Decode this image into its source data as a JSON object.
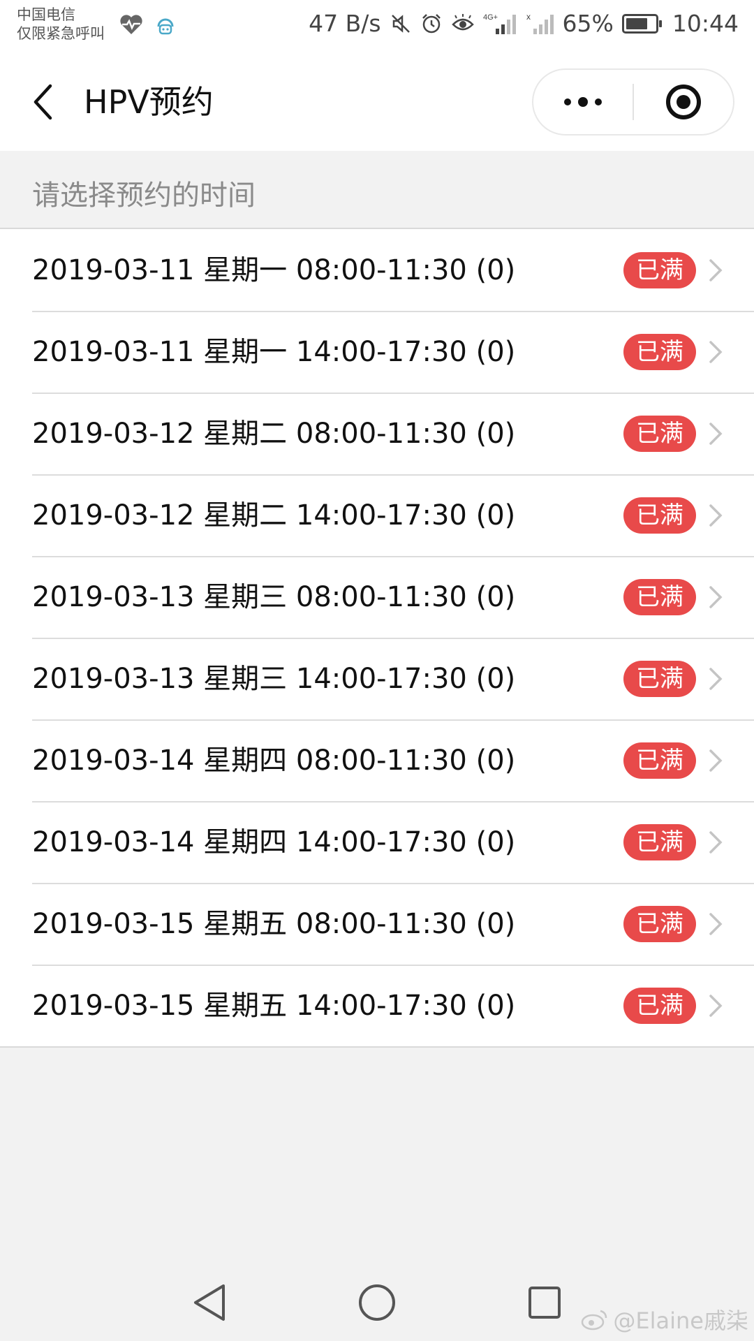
{
  "status_bar": {
    "carrier_line1": "中国电信",
    "carrier_line2": "仅限紧急呼叫",
    "net_speed": "47 B/s",
    "battery": "65%",
    "time": "10:44"
  },
  "nav": {
    "title": "HPV预约"
  },
  "section": {
    "header": "请选择预约的时间"
  },
  "slots": [
    {
      "text": "2019-03-11 星期一 08:00-11:30 (0)",
      "status": "已满"
    },
    {
      "text": "2019-03-11 星期一 14:00-17:30 (0)",
      "status": "已满"
    },
    {
      "text": "2019-03-12 星期二 08:00-11:30 (0)",
      "status": "已满"
    },
    {
      "text": "2019-03-12 星期二 14:00-17:30 (0)",
      "status": "已满"
    },
    {
      "text": "2019-03-13 星期三 08:00-11:30 (0)",
      "status": "已满"
    },
    {
      "text": "2019-03-13 星期三 14:00-17:30 (0)",
      "status": "已满"
    },
    {
      "text": "2019-03-14 星期四 08:00-11:30 (0)",
      "status": "已满"
    },
    {
      "text": "2019-03-14 星期四 14:00-17:30 (0)",
      "status": "已满"
    },
    {
      "text": "2019-03-15 星期五 08:00-11:30 (0)",
      "status": "已满"
    },
    {
      "text": "2019-03-15 星期五 14:00-17:30 (0)",
      "status": "已满"
    }
  ],
  "watermark": "@Elaine戚柒",
  "colors": {
    "badge_red": "#e84a4a",
    "background": "#f2f2f2"
  }
}
